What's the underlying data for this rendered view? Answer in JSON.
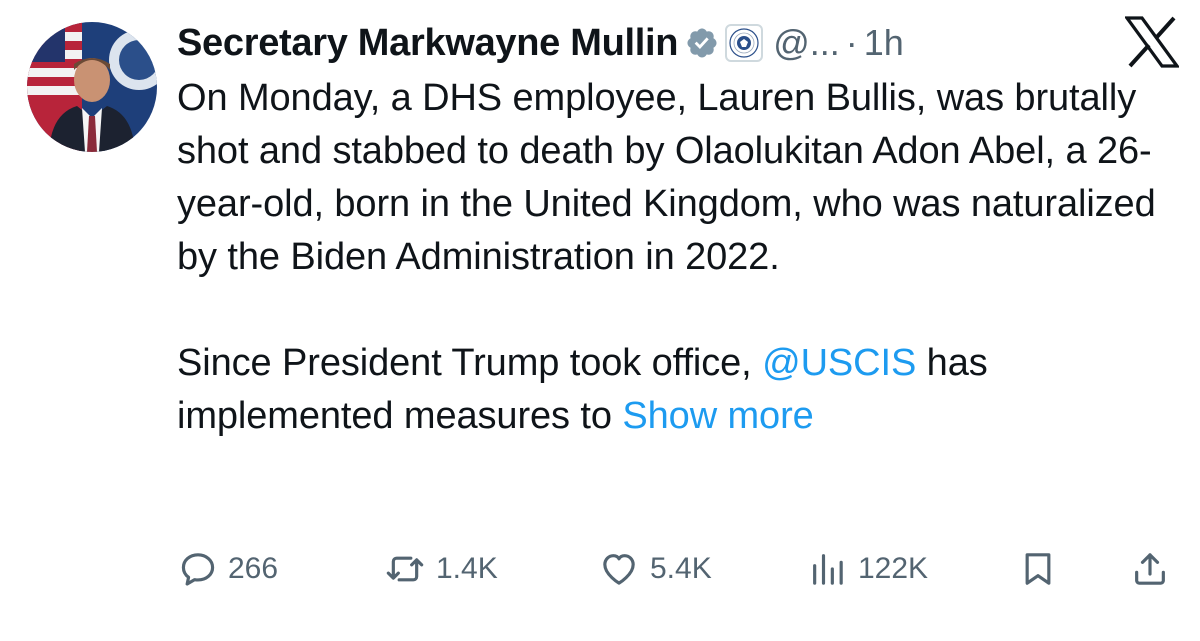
{
  "author": {
    "display_name": "Secretary Markwayne Mullin",
    "handle": "@...",
    "separator": "·",
    "time": "1h",
    "avatar_icon": "profile-photo",
    "verified_icon": "verified-badge-icon",
    "affiliate_icon": "dhs-seal-icon"
  },
  "tweet": {
    "paragraph1": "On Monday, a DHS employee, Lauren Bullis, was brutally shot and stabbed to death by Olaolukitan Adon Abel, a 26-year-old, born in the United Kingdom, who was naturalized by the Biden Administration in 2022.",
    "paragraph2_before": "Since President Trump took office, ",
    "mention": "@USCIS",
    "paragraph2_after": " has implemented measures to ",
    "show_more": "Show more"
  },
  "actions": {
    "replies": "266",
    "reposts": "1.4K",
    "likes": "5.4K",
    "views": "122K"
  },
  "colors": {
    "text": "#0f1419",
    "secondary": "#536471",
    "link": "#1d9bf0"
  }
}
